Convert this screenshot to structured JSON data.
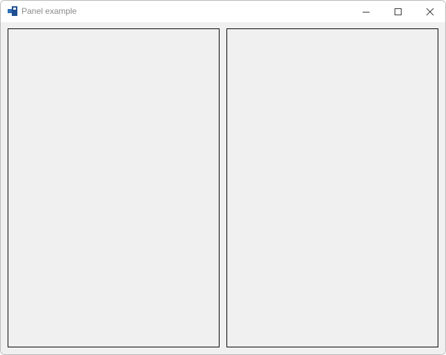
{
  "window": {
    "title": "Panel example"
  },
  "titlebar": {
    "icon": "app-window-icon",
    "buttons": {
      "minimize": "minimize-icon",
      "maximize": "maximize-icon",
      "close": "close-icon"
    }
  },
  "colors": {
    "client_background": "#f0f0f0",
    "titlebar_background": "#ffffff",
    "panel_border": "#000000",
    "icon_accent": "#1f4f8f"
  }
}
